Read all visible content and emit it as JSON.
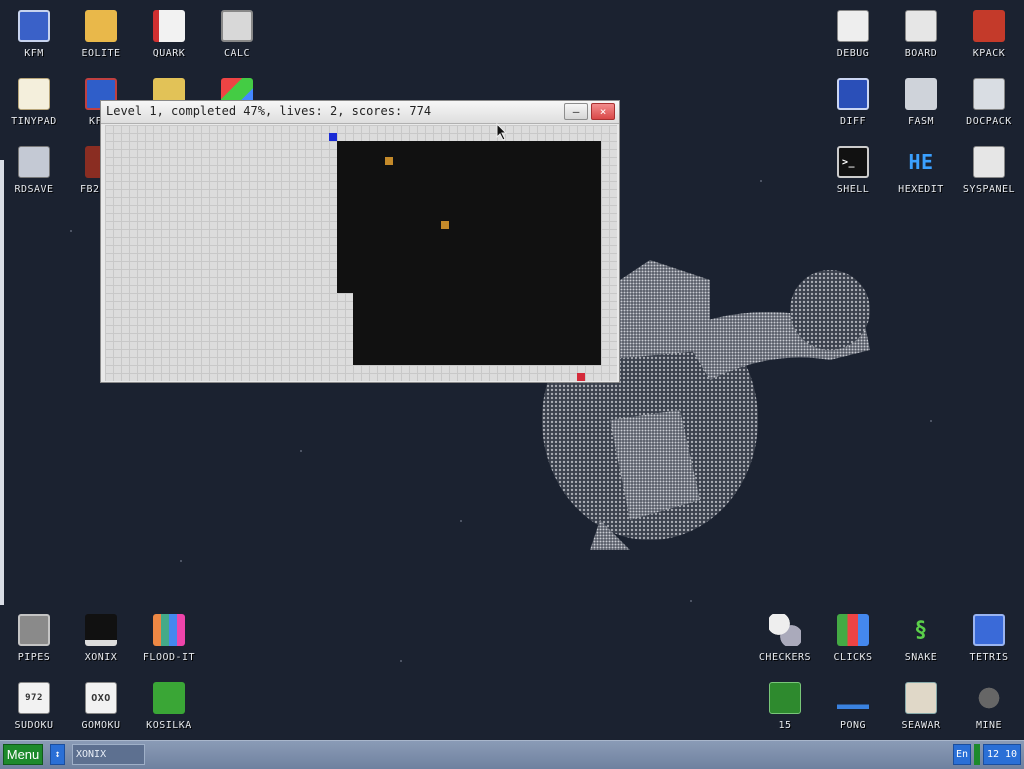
{
  "window": {
    "title": "Level 1, completed 47%, lives: 2, scores: 774",
    "minimize_glyph": "–",
    "close_glyph": "×",
    "game": {
      "level": 1,
      "completed_percent": 47,
      "lives": 2,
      "score": 774,
      "player_color": "#1a2bd6",
      "enemy_color": "#c48a2a",
      "land_enemy_color": "#d42a3a"
    }
  },
  "desktop_icons": {
    "kfm": "KFM",
    "eolite": "EOLITE",
    "quark": "QUARK",
    "calc": "CALC",
    "tinypad": "TINYPAD",
    "kf_partial": "KF",
    "rdsave": "RDSAVE",
    "fb2_partial": "FB2",
    "debug": "DEBUG",
    "board": "BOARD",
    "kpack": "KPACK",
    "diff": "DIFF",
    "fasm": "FASM",
    "docpack": "DOCPACK",
    "shell": "SHELL",
    "hexedit": "HEXEDIT",
    "syspanel": "SYSPANEL",
    "pipes": "PIPES",
    "xonix": "XONIX",
    "floodit": "FLOOD-IT",
    "sudoku": "SUDOKU",
    "gomoku": "GOMOKU",
    "kosilka": "KOSILKA",
    "checkers": "CHECKERS",
    "clicks": "CLICKS",
    "snake": "SNAKE",
    "tetris": "TETRIS",
    "fifteen": "15",
    "pong": "PONG",
    "seawar": "SEAWAR",
    "mine": "MINE"
  },
  "icon_glyphs": {
    "shell": ">_",
    "hexedit": "HE",
    "sudoku": "972",
    "gomoku": "OXO"
  },
  "taskbar": {
    "menu_label": "Menu",
    "arrow_glyph": "↕",
    "task_label": "XONIX",
    "lang": "En",
    "clock": "12 10"
  }
}
